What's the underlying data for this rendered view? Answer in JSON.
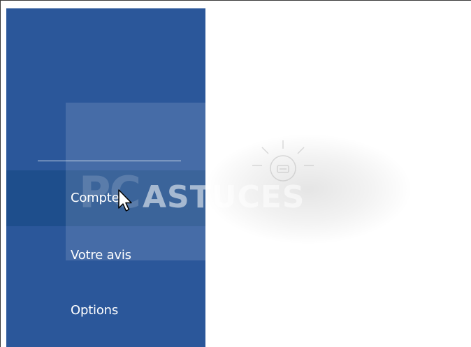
{
  "menu": {
    "items": [
      {
        "label": "Compte",
        "selected": true
      },
      {
        "label": "Votre avis",
        "selected": false
      },
      {
        "label": "Options",
        "selected": false
      }
    ]
  },
  "watermark": {
    "pc": "PC",
    "astuces": "ASTUCES"
  },
  "colors": {
    "sidebar": "#2b579a",
    "selected": "#1e4e8c",
    "content": "#ffffff"
  }
}
